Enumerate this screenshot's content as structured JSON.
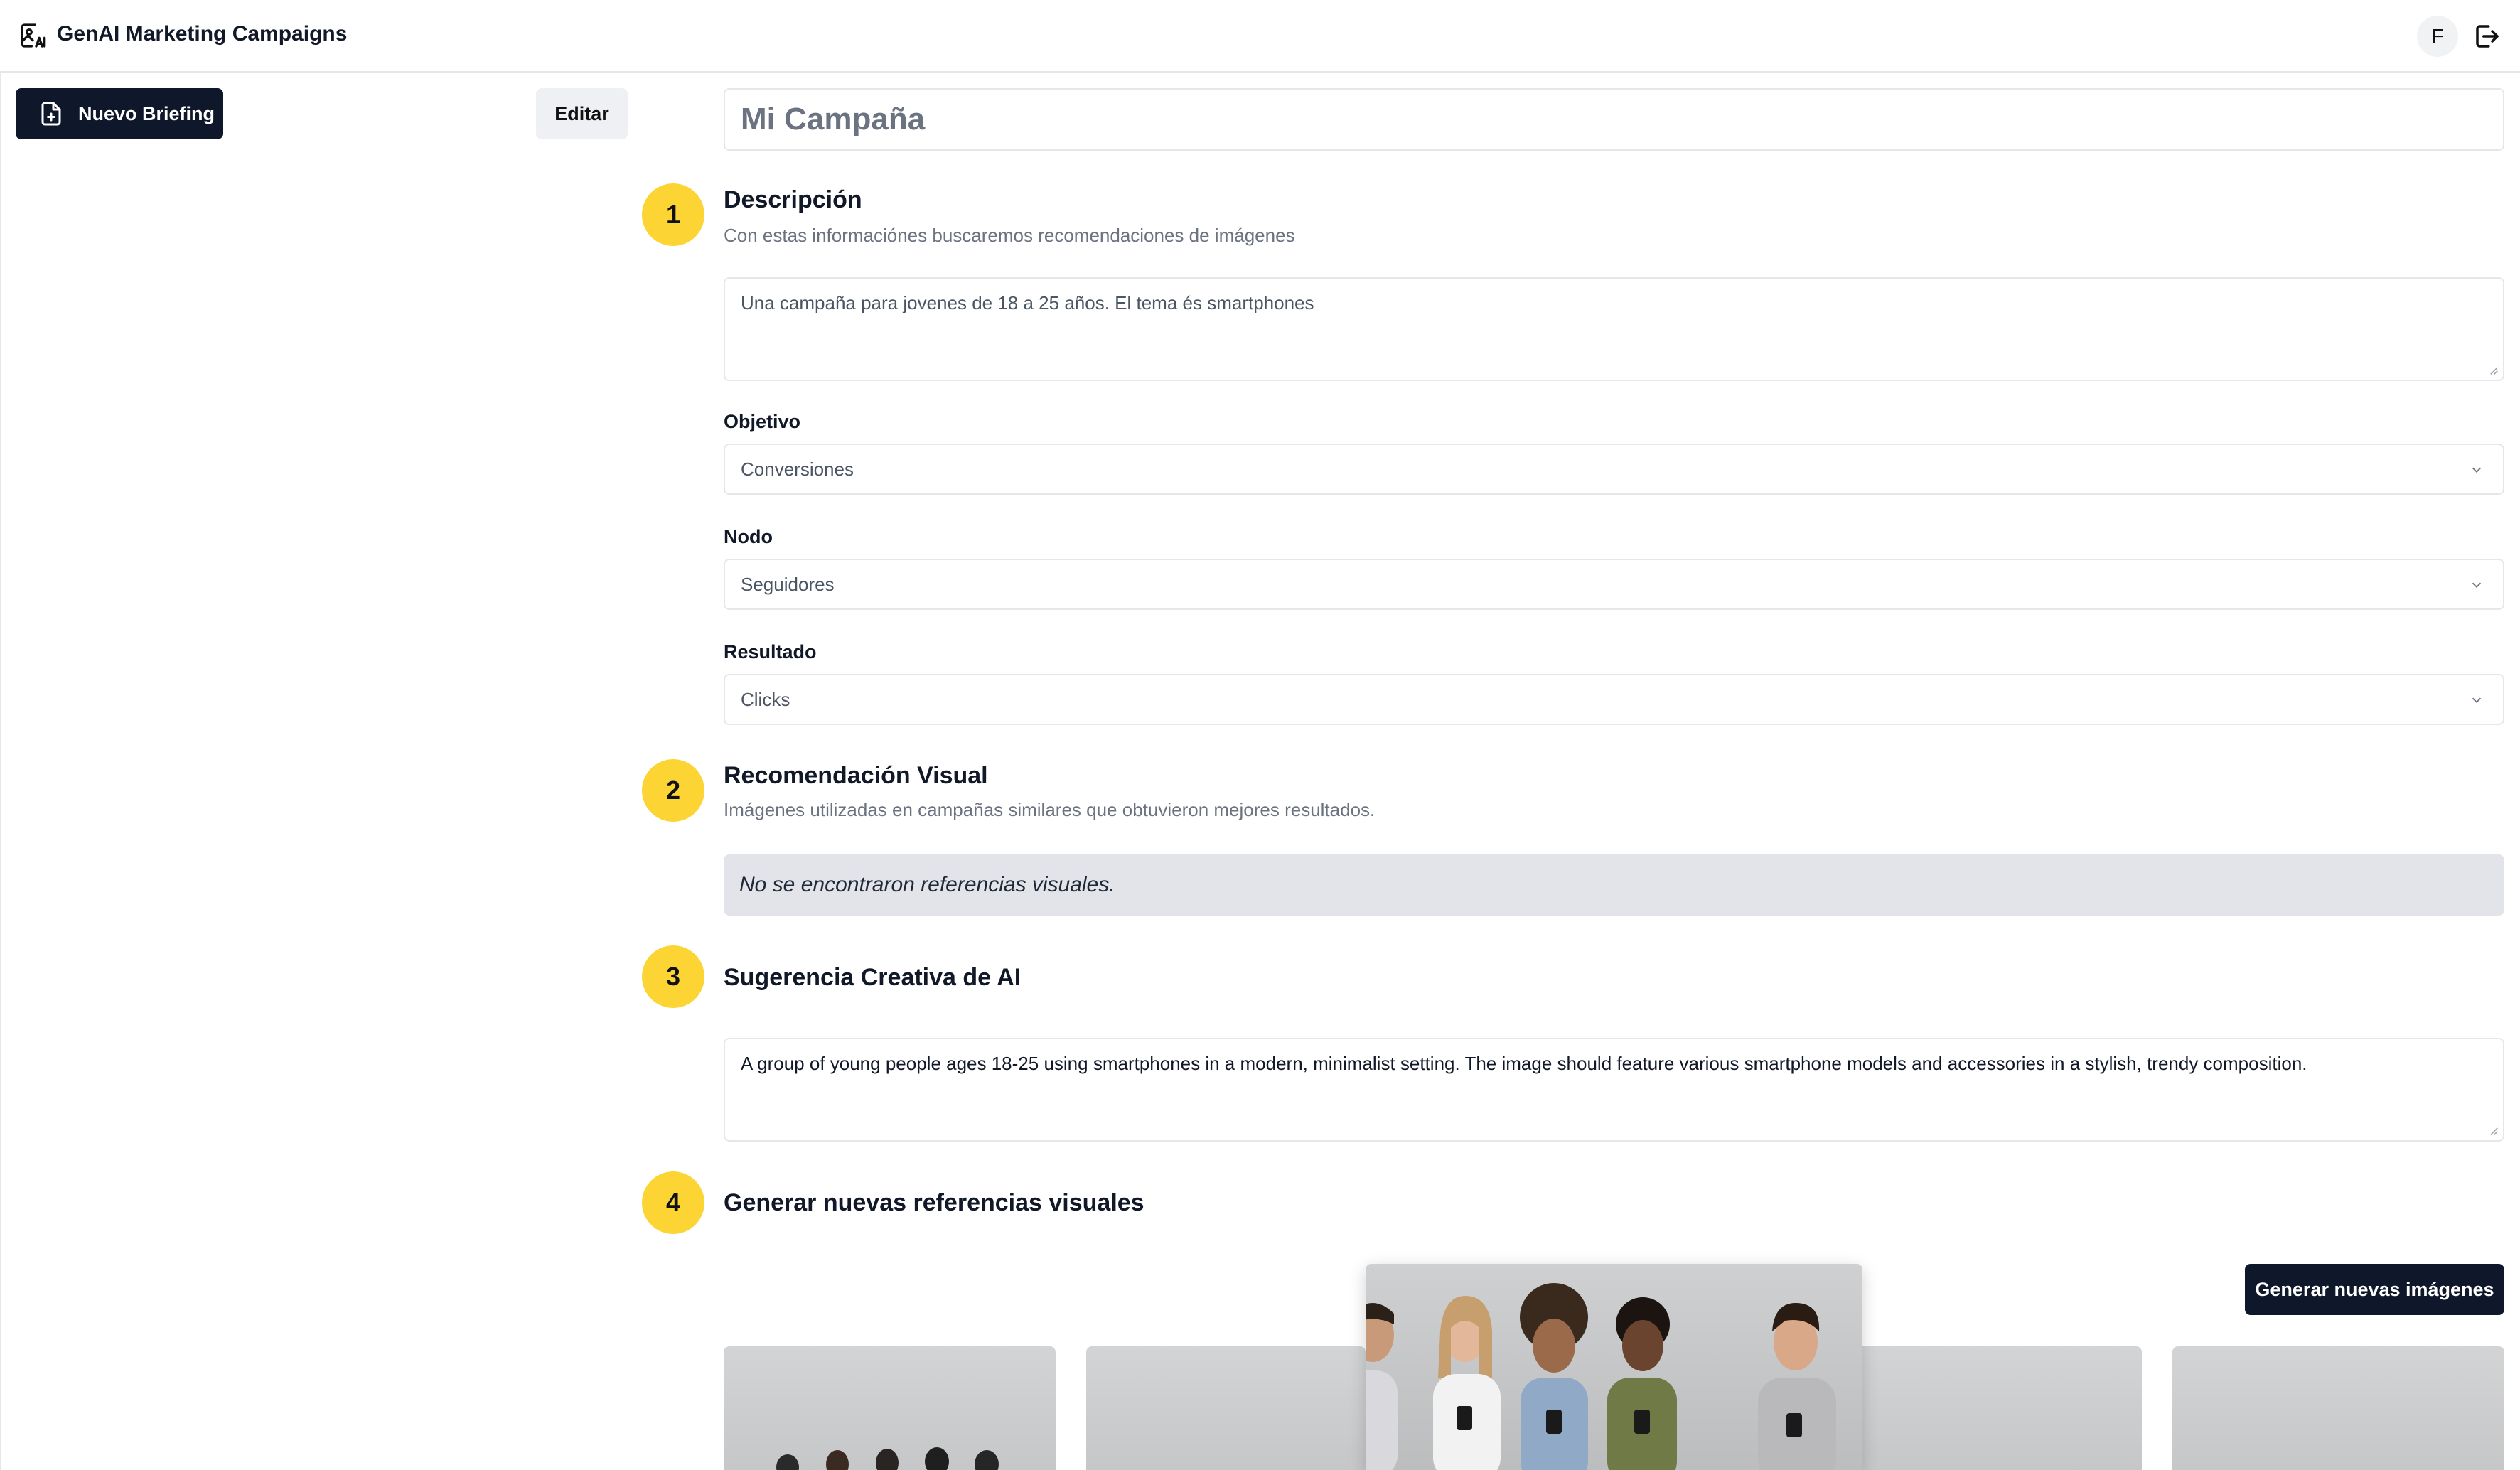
{
  "header": {
    "app_title": "GenAI Marketing Campaigns",
    "avatar_initial": "F",
    "logo_icon": "image-ai-icon",
    "logout_icon": "logout-icon"
  },
  "sidebar": {
    "new_briefing_label": "Nuevo Briefing",
    "new_briefing_icon": "file-plus-icon",
    "edit_label": "Editar"
  },
  "campaign": {
    "name": "Mi Campaña"
  },
  "steps": [
    {
      "number": "1",
      "title": "Descripción",
      "subtitle": "Con estas informaciónes buscaremos recomendaciones de imágenes",
      "description_value": "Una campaña para jovenes de 18 a 25 años. El tema és smartphones",
      "fields": [
        {
          "label": "Objetivo",
          "value": "Conversiones"
        },
        {
          "label": "Nodo",
          "value": "Seguidores"
        },
        {
          "label": "Resultado",
          "value": "Clicks"
        }
      ]
    },
    {
      "number": "2",
      "title": "Recomendación Visual",
      "subtitle": "Imágenes utilizadas en campañas similares que obtuvieron mejores resultados.",
      "empty_message": "No se encontraron referencias visuales."
    },
    {
      "number": "3",
      "title": "Sugerencia Creativa de AI",
      "suggestion": "A group of young people ages 18-25 using smartphones in a modern, minimalist setting. The image should feature various smartphone models and accessories in a stylish, trendy composition."
    },
    {
      "number": "4",
      "title": "Generar nuevas referencias visuales",
      "generate_label": "Generar nuevas imágenes"
    }
  ],
  "colors": {
    "accent_yellow": "#fcd535",
    "button_dark": "#0f172a",
    "empty_bg": "#e2e4e9"
  }
}
